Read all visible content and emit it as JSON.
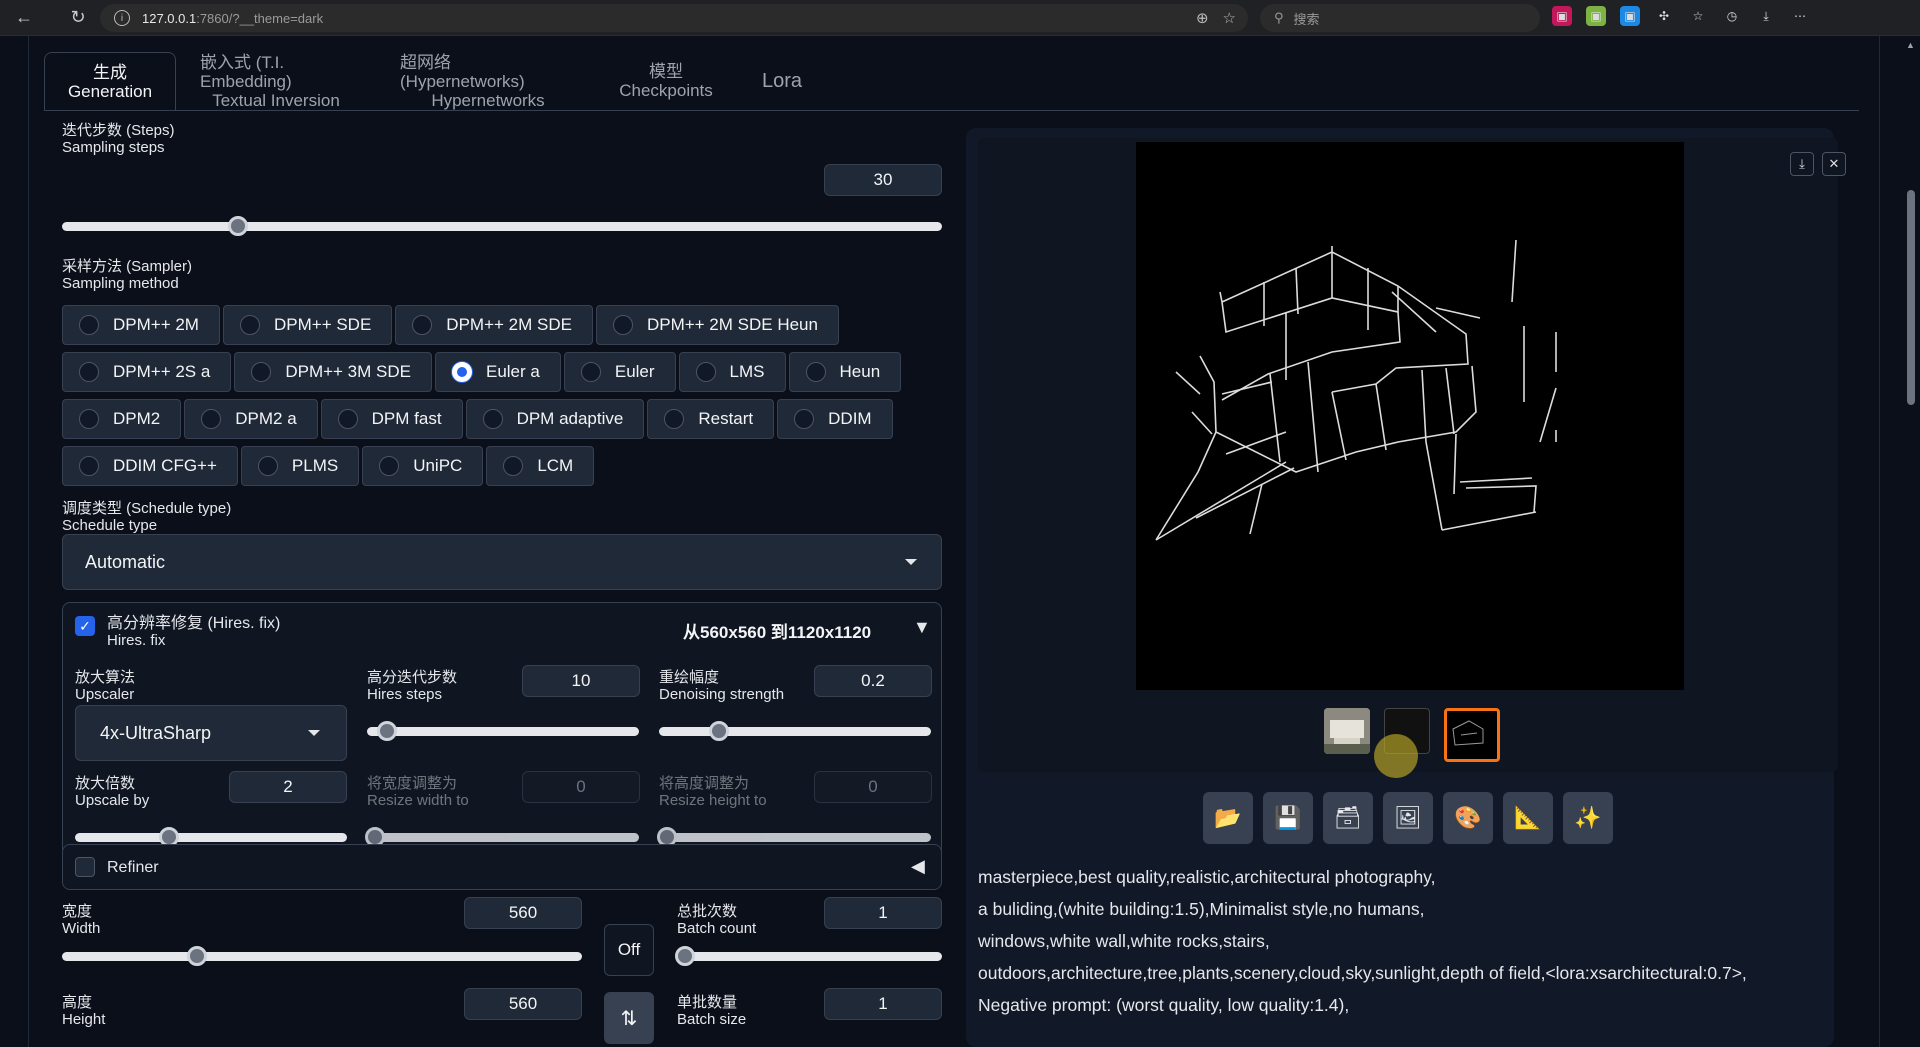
{
  "browser": {
    "url_host": "127.0.0.1",
    "url_path": ":7860/?__theme=dark",
    "search_placeholder": "搜索"
  },
  "tabs": [
    {
      "cn": "生成",
      "en": "Generation",
      "active": true
    },
    {
      "cn": "嵌入式 (T.I. Embedding)",
      "en": "Textual Inversion"
    },
    {
      "cn": "超网络 (Hypernetworks)",
      "en": "Hypernetworks"
    },
    {
      "cn": "模型",
      "en": "Checkpoints"
    },
    {
      "cn": "Lora",
      "en": ""
    }
  ],
  "steps": {
    "cn": "迭代步数 (Steps)",
    "en": "Sampling steps",
    "value": "30",
    "fraction": 0.2
  },
  "sampler": {
    "cn": "采样方法 (Sampler)",
    "en": "Sampling method",
    "rows": [
      [
        "DPM++ 2M",
        "DPM++ SDE",
        "DPM++ 2M SDE",
        "DPM++ 2M SDE Heun"
      ],
      [
        "DPM++ 2S a",
        "DPM++ 3M SDE",
        "Euler a",
        "Euler",
        "LMS",
        "Heun"
      ],
      [
        "DPM2",
        "DPM2 a",
        "DPM fast",
        "DPM adaptive",
        "Restart",
        "DDIM"
      ],
      [
        "DDIM CFG++",
        "PLMS",
        "UniPC",
        "LCM"
      ]
    ],
    "selected": "Euler a"
  },
  "schedule": {
    "cn": "调度类型 (Schedule type)",
    "en": "Schedule type",
    "value": "Automatic"
  },
  "hires": {
    "cn": "高分辨率修复 (Hires. fix)",
    "en": "Hires. fix",
    "checked": true,
    "summary": "从560x560 到1120x1120",
    "upscaler": {
      "cn": "放大算法",
      "en": "Upscaler",
      "value": "4x-UltraSharp"
    },
    "hires_steps": {
      "cn": "高分迭代步数",
      "en": "Hires steps",
      "value": "10",
      "fraction": 0.07
    },
    "denoise": {
      "cn": "重绘幅度",
      "en": "Denoising strength",
      "value": "0.2",
      "fraction": 0.2
    },
    "upscale_by": {
      "cn": "放大倍数",
      "en": "Upscale by",
      "value": "2",
      "fraction": 0.33
    },
    "resize_w": {
      "cn": "将宽度调整为",
      "en": "Resize width to",
      "value": "0"
    },
    "resize_h": {
      "cn": "将高度调整为",
      "en": "Resize height to",
      "value": "0"
    }
  },
  "refiner": {
    "label": "Refiner",
    "checked": false
  },
  "width": {
    "cn": "宽度",
    "en": "Width",
    "value": "560",
    "fraction": 0.26
  },
  "height": {
    "cn": "高度",
    "en": "Height",
    "value": "560"
  },
  "off_label": "Off",
  "batch_count": {
    "cn": "总批次数",
    "en": "Batch count",
    "value": "1"
  },
  "batch_size": {
    "cn": "单批数量",
    "en": "Batch size",
    "value": "1"
  },
  "toolbar_icons": [
    "folder-icon",
    "save-icon",
    "zip-icon",
    "send-to-img2img-icon",
    "send-to-inpaint-icon",
    "send-to-extras-icon",
    "sparkle-icon"
  ],
  "output_text": [
    "masterpiece,best quality,realistic,architectural photography,",
    "a buliding,(white building:1.5),Minimalist style,no humans,",
    "windows,white wall,white rocks,stairs,",
    "outdoors,architecture,tree,plants,scenery,cloud,sky,sunlight,depth of field,<lora:xsarchitectural:0.7>,",
    "Negative prompt: (worst quality, low quality:1.4),"
  ],
  "colors": {
    "accent": "#2563eb",
    "bg": "#0b0f19",
    "thumb_border": "#f97316"
  }
}
